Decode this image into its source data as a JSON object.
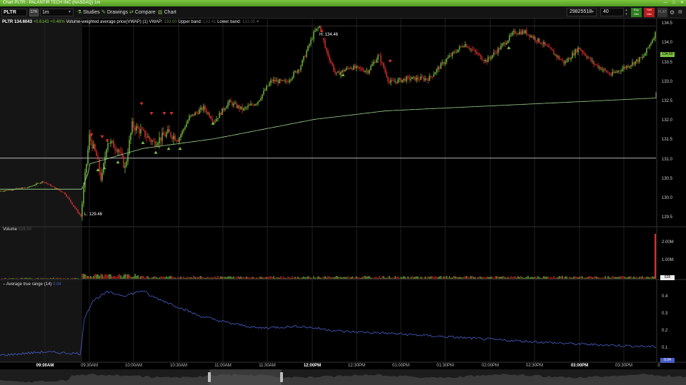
{
  "window": {
    "title": "Chart PLTR - PALANTIR TECH INC (NASDAQ) 1m",
    "minimize": "—",
    "restore": "□",
    "close": "✕"
  },
  "toolbar": {
    "symbol": "PLTR",
    "str_label": "STR",
    "interval": "1m",
    "studies_label": "Studies",
    "drawings_label": "Drawings",
    "compare_label": "Compare",
    "chart_label": "Chart",
    "account": "29825518",
    "quantity": "40",
    "buy_label_1": "Buy",
    "buy_label_2": "Mkt",
    "sell_label_1": "Sell",
    "sell_label_2": "Mkt",
    "flat_label": "FLAT",
    "icons": {
      "studies": "studies-icon",
      "drawings": "drawings-icon",
      "compare": "compare-icon",
      "chart": "chart-type-icon",
      "settings": "gear-icon"
    }
  },
  "legend": {
    "symbol": "PLTR",
    "price": "134.6043",
    "change": "+0.6143",
    "change_pct": "+0.46%",
    "study_name": "Volume-weighted average price(VWAP) (1)",
    "vwap_label": "VWAP:",
    "vwap_value": "133.00",
    "upper_label": "Upper band:",
    "upper_value": "133.41",
    "lower_label": "Lower band:",
    "lower_value": "133.05",
    "close_x": "×",
    "high_label": "H: 134.46",
    "low_label": "L: 129.46"
  },
  "volume_panel": {
    "title": "Volume",
    "value": "628.00",
    "last_label": "628"
  },
  "atr_panel": {
    "title": "Average true range (14)",
    "value": "0.04",
    "last_label": "0.04"
  },
  "price_axis_labels": [
    "134.5",
    "134.0",
    "133.5",
    "133.0",
    "132.5",
    "132.0",
    "131.5",
    "131.0",
    "130.5",
    "130.0",
    "129.5"
  ],
  "last_price_tag": "134.60",
  "volume_axis_labels": [
    "2.00M",
    "1.00M"
  ],
  "atr_axis_labels": [
    "0.4",
    "0.3",
    "0.2",
    "0.1"
  ],
  "x_axis": [
    {
      "label": "09:00AM",
      "bold": true
    },
    {
      "label": "09:30AM",
      "bold": false
    },
    {
      "label": "10:00AM",
      "bold": false
    },
    {
      "label": "10:30AM",
      "bold": false
    },
    {
      "label": "11:00AM",
      "bold": false
    },
    {
      "label": "11:30AM",
      "bold": false
    },
    {
      "label": "12:00PM",
      "bold": true
    },
    {
      "label": "12:30PM",
      "bold": false
    },
    {
      "label": "01:00PM",
      "bold": false
    },
    {
      "label": "01:30PM",
      "bold": false
    },
    {
      "label": "02:00PM",
      "bold": false
    },
    {
      "label": "02:30PM",
      "bold": false
    },
    {
      "label": "03:00PM",
      "bold": true
    },
    {
      "label": "03:30PM",
      "bold": false
    }
  ],
  "x_axis_end_label": "0",
  "colors": {
    "up": "#7cc242",
    "down": "#e03030",
    "vwap": "#9fd58f",
    "atr": "#4a5ec8",
    "panel_border": "#2a2a2a"
  }
}
